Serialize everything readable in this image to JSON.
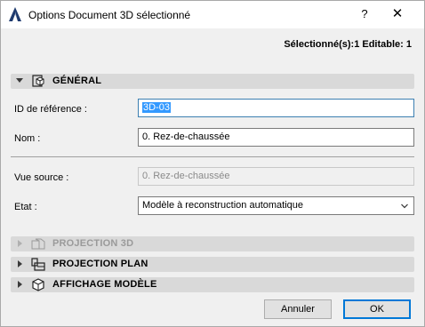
{
  "window": {
    "title": "Options Document 3D sélectionné",
    "help_label": "?",
    "close_label": "✕"
  },
  "selection_info": "Sélectionné(s):1 Editable: 1",
  "sections": {
    "general": {
      "label": "GÉNÉRAL",
      "expanded": true,
      "icon": "document-3d-icon"
    },
    "projection3d": {
      "label": "PROJECTION 3D",
      "expanded": false,
      "enabled": false,
      "icon": "projection-3d-icon"
    },
    "projection_plan": {
      "label": "PROJECTION PLAN",
      "expanded": false,
      "icon": "floor-plan-icon"
    },
    "affichage_modele": {
      "label": "AFFICHAGE MODÈLE",
      "expanded": false,
      "icon": "model-cube-icon"
    }
  },
  "fields": {
    "reference": {
      "label": "ID de référence :",
      "value": "3D-03"
    },
    "nom": {
      "label": "Nom :",
      "value": "0. Rez-de-chaussée"
    },
    "vue_source": {
      "label": "Vue source :",
      "value": "0. Rez-de-chaussée"
    },
    "etat": {
      "label": "Etat :",
      "value": "Modèle à reconstruction automatique"
    }
  },
  "buttons": {
    "cancel": "Annuler",
    "ok": "OK"
  },
  "colors": {
    "selection": "#3399ff",
    "default_button_border": "#0078d7",
    "section_bg": "#d9d9d9"
  }
}
